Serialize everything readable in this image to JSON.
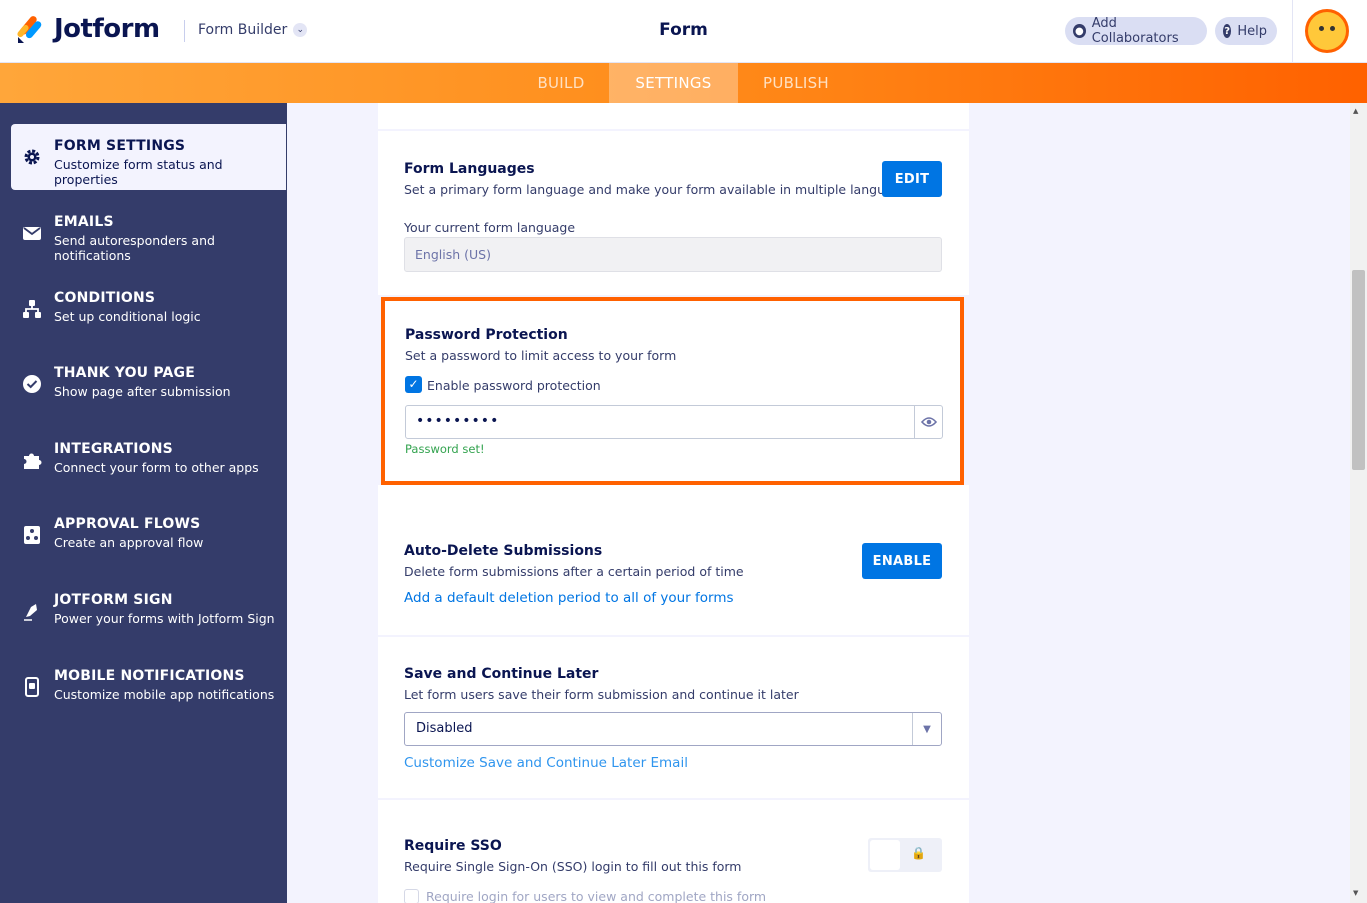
{
  "header": {
    "logo_text": "Jotform",
    "builder_label": "Form Builder",
    "title": "Form",
    "add_collaborators": "Add Collaborators",
    "help": "Help"
  },
  "nav": {
    "tabs": [
      {
        "label": "BUILD",
        "active": false
      },
      {
        "label": "SETTINGS",
        "active": true
      },
      {
        "label": "PUBLISH",
        "active": false
      }
    ]
  },
  "sidebar": {
    "items": [
      {
        "title": "FORM SETTINGS",
        "subtitle": "Customize form status and properties",
        "icon": "gear-icon",
        "active": true
      },
      {
        "title": "EMAILS",
        "subtitle": "Send autoresponders and notifications",
        "icon": "envelope-icon",
        "active": false
      },
      {
        "title": "CONDITIONS",
        "subtitle": "Set up conditional logic",
        "icon": "hierarchy-icon",
        "active": false
      },
      {
        "title": "THANK YOU PAGE",
        "subtitle": "Show page after submission",
        "icon": "check-circle-icon",
        "active": false
      },
      {
        "title": "INTEGRATIONS",
        "subtitle": "Connect your form to other apps",
        "icon": "puzzle-icon",
        "active": false
      },
      {
        "title": "APPROVAL FLOWS",
        "subtitle": "Create an approval flow",
        "icon": "approval-icon",
        "active": false
      },
      {
        "title": "JOTFORM SIGN",
        "subtitle": "Power your forms with Jotform Sign",
        "icon": "pen-icon",
        "active": false
      },
      {
        "title": "MOBILE NOTIFICATIONS",
        "subtitle": "Customize mobile app notifications",
        "icon": "mobile-icon",
        "active": false
      }
    ]
  },
  "settings": {
    "languages": {
      "title": "Form Languages",
      "description": "Set a primary form language and make your form available in multiple languages.",
      "button": "EDIT",
      "current_label": "Your current form language",
      "current_value": "English (US)"
    },
    "password": {
      "title": "Password Protection",
      "description": "Set a password to limit access to your form",
      "checkbox_label": "Enable password protection",
      "checked": true,
      "value": "•••••••••",
      "status": "Password set!"
    },
    "auto_delete": {
      "title": "Auto-Delete Submissions",
      "description": "Delete form submissions after a certain period of time",
      "button": "ENABLE",
      "link": "Add a default deletion period to all of your forms"
    },
    "save_continue": {
      "title": "Save and Continue Later",
      "description": "Let form users save their form submission and continue it later",
      "selected": "Disabled",
      "link": "Customize Save and Continue Later Email"
    },
    "sso": {
      "title": "Require SSO",
      "description": "Require Single Sign-On (SSO) login to fill out this form",
      "checkbox_label": "Require login for users to view and complete this form"
    }
  },
  "colors": {
    "accent_orange": "#ff6100",
    "primary_blue": "#0075e3",
    "sidebar_bg": "#343c6a",
    "success_green": "#33a34f"
  }
}
